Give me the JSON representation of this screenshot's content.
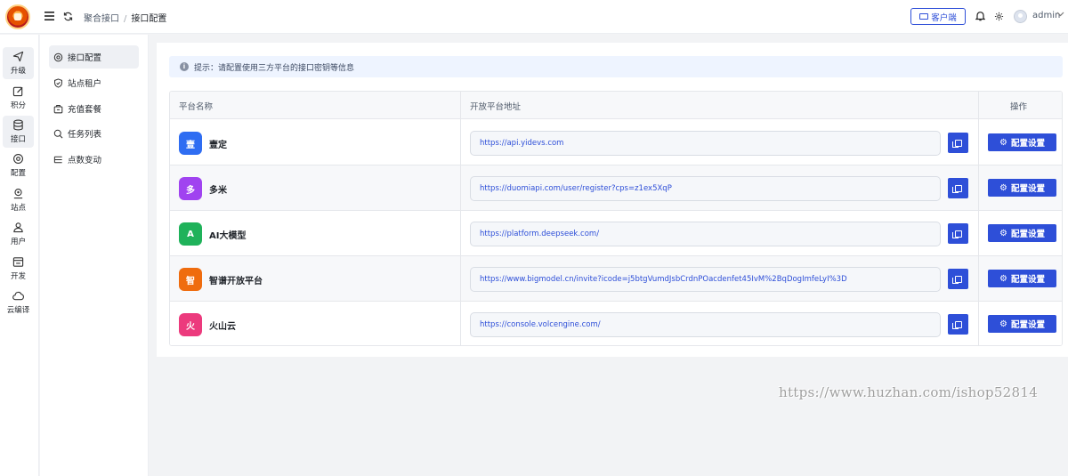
{
  "header": {
    "breadcrumb_parent": "聚合接口",
    "breadcrumb_sep": "/",
    "breadcrumb_current": "接口配置",
    "client_button": "客户端",
    "user_name": "admin"
  },
  "rail": {
    "items": [
      {
        "label": "升级",
        "icon": "send-icon",
        "active": true
      },
      {
        "label": "积分",
        "icon": "edit-icon",
        "active": false
      },
      {
        "label": "接口",
        "icon": "database-icon",
        "active": true
      },
      {
        "label": "配置",
        "icon": "settings-icon",
        "active": false
      },
      {
        "label": "站点",
        "icon": "location-icon",
        "active": false
      },
      {
        "label": "用户",
        "icon": "user-icon",
        "active": false
      },
      {
        "label": "开发",
        "icon": "code-icon",
        "active": false
      },
      {
        "label": "云编译",
        "icon": "cloud-icon",
        "active": false
      }
    ]
  },
  "submenu": {
    "items": [
      {
        "label": "接口配置",
        "icon": "target-icon",
        "active": true
      },
      {
        "label": "站点租户",
        "icon": "shield-icon",
        "active": false
      },
      {
        "label": "充值套餐",
        "icon": "package-icon",
        "active": false
      },
      {
        "label": "任务列表",
        "icon": "search-icon",
        "active": false
      },
      {
        "label": "点数变动",
        "icon": "list-icon",
        "active": false
      }
    ]
  },
  "main": {
    "tip": "提示：请配置使用三方平台的接口密钥等信息",
    "columns": [
      "平台名称",
      "开放平台地址",
      "操作"
    ],
    "config_button": "配置设置",
    "rows": [
      {
        "badge": "壹",
        "name": "壹定",
        "url": "https://api.yidevs.com",
        "color": "#2f6df2"
      },
      {
        "badge": "多",
        "name": "多米",
        "url": "https://duomiapi.com/user/register?cps=z1ex5XqP",
        "color": "#a043f0"
      },
      {
        "badge": "A",
        "name": "AI大模型",
        "url": "https://platform.deepseek.com/",
        "color": "#1fb25a"
      },
      {
        "badge": "智",
        "name": "智谱开放平台",
        "url": "https://www.bigmodel.cn/invite?icode=j5btgVumdJsbCrdnPOacdenfet45IvM%2BqDogImfeLyI%3D",
        "color": "#ef6c0e"
      },
      {
        "badge": "火",
        "name": "火山云",
        "url": "https://console.volcengine.com/",
        "color": "#ec3a7d"
      }
    ]
  },
  "watermark": "https://www.huzhan.com/ishop52814"
}
